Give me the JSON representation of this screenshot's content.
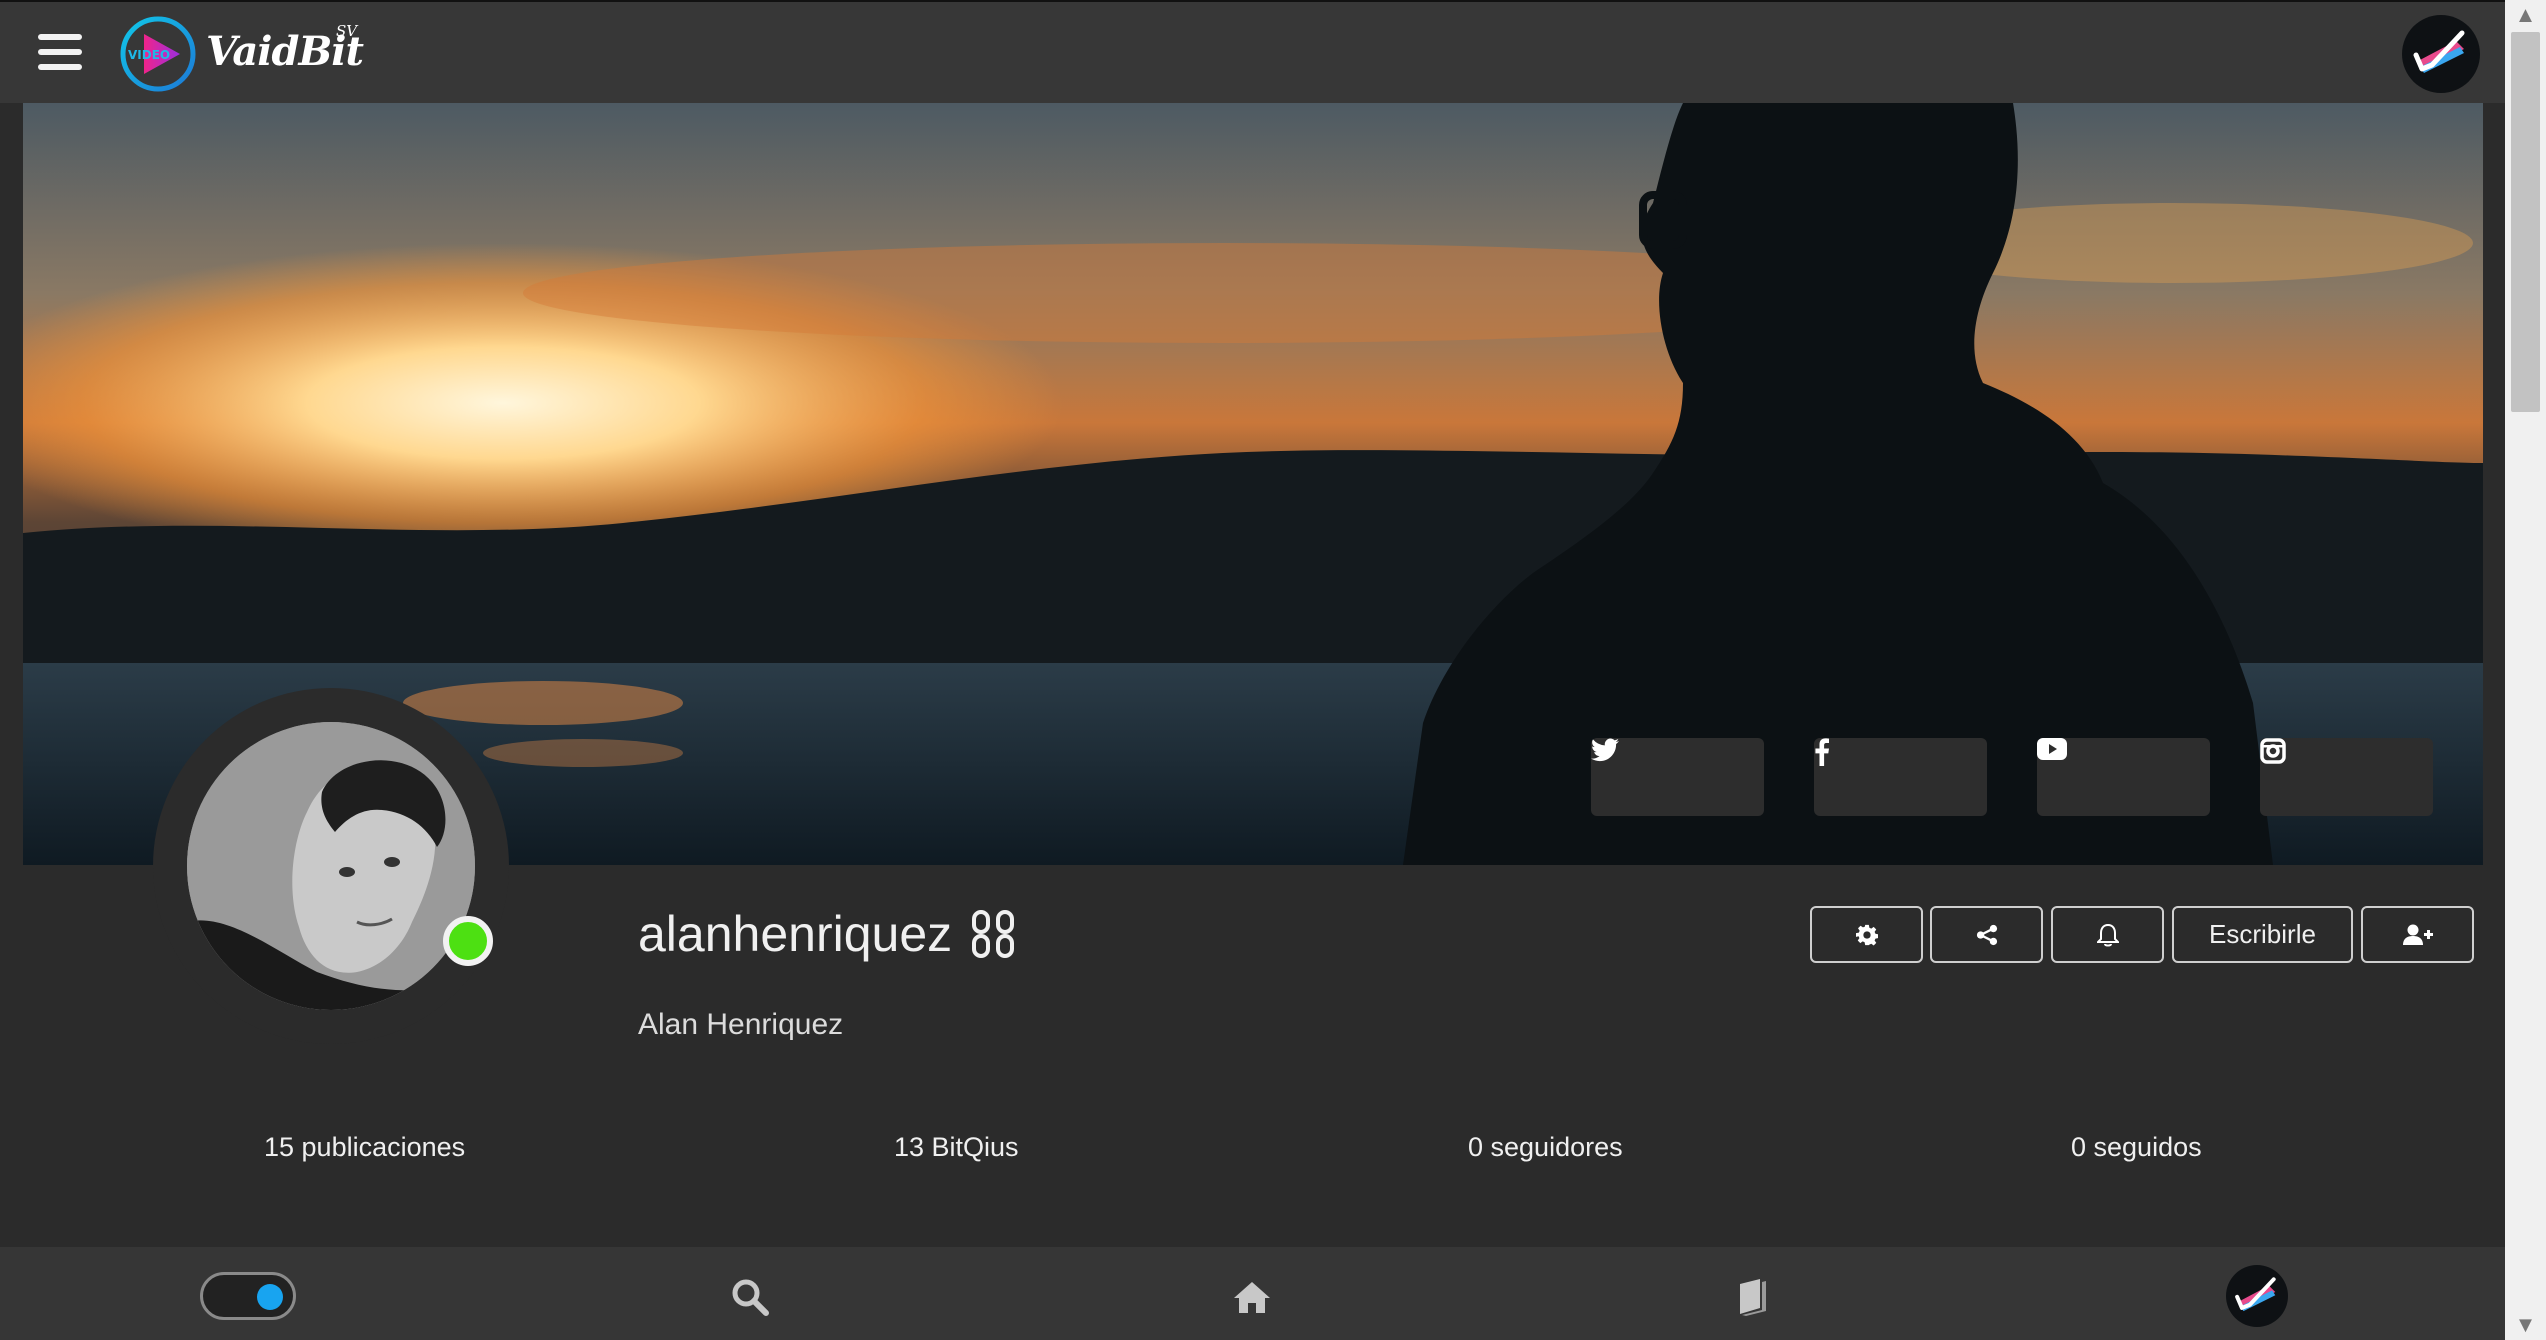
{
  "header": {
    "menu_icon": "hamburger-menu-icon",
    "logo_text": "VaidBit",
    "logo_superscript": "SV",
    "logo_mark_text": "VIDEO",
    "avatar_icon": "user-avatar"
  },
  "cover": {
    "image": "sunset-silhouette-cover-photo",
    "social_buttons": [
      {
        "icon": "twitter-icon"
      },
      {
        "icon": "facebook-icon"
      },
      {
        "icon": "youtube-icon"
      },
      {
        "icon": "instagram-icon"
      }
    ]
  },
  "profile": {
    "username": "alanhenriquez",
    "verified_icon": "chain-link-icon",
    "full_name": "Alan Henriquez",
    "online": true,
    "actions": {
      "settings_icon": "gear-icon",
      "share_icon": "share-icon",
      "notify_icon": "bell-icon",
      "write_label": "Escribirle",
      "follow_icon": "add-user-icon"
    },
    "stats": {
      "posts": "15 publicaciones",
      "bitqius": "13 BitQius",
      "followers": "0 seguidores",
      "following": "0 seguidos"
    }
  },
  "bottom_nav": {
    "toggle_on": true,
    "items": [
      "search-icon",
      "home-icon",
      "book-icon",
      "user-avatar"
    ]
  },
  "colors": {
    "background": "#2b2b2b",
    "bar": "#373737",
    "online": "#4de012",
    "toggle_accent": "#18a4f0"
  }
}
